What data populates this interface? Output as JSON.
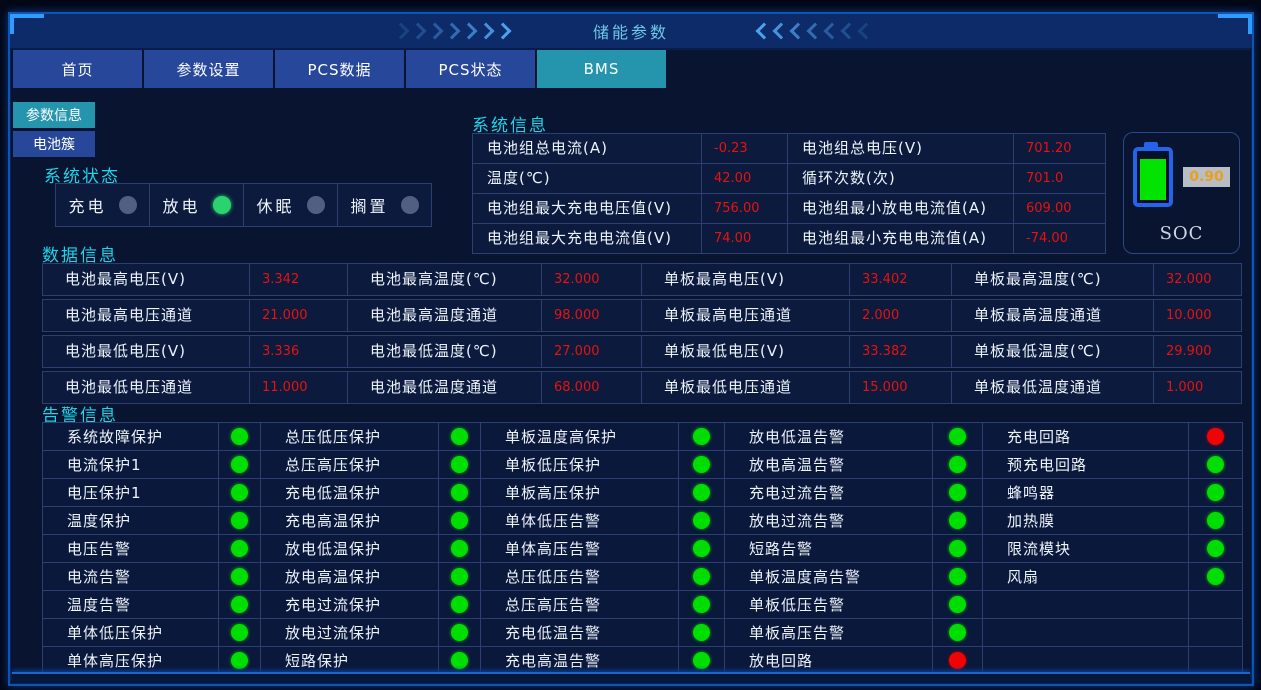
{
  "header": {
    "title": "储能参数"
  },
  "tabs": [
    {
      "name": "home",
      "label": "首页",
      "active": false
    },
    {
      "name": "param-settings",
      "label": "参数设置",
      "active": false
    },
    {
      "name": "pcs-data",
      "label": "PCS数据",
      "active": false
    },
    {
      "name": "pcs-status",
      "label": "PCS状态",
      "active": false
    },
    {
      "name": "bms",
      "label": "BMS",
      "active": true
    }
  ],
  "side_buttons": [
    {
      "name": "param-info",
      "label": "参数信息",
      "active": true
    },
    {
      "name": "battery-cluster",
      "label": "电池簇",
      "active": false
    }
  ],
  "system_status": {
    "title": "系统状态",
    "items": [
      {
        "name": "charge",
        "label": "充电",
        "state": "off"
      },
      {
        "name": "discharge",
        "label": "放电",
        "state": "on"
      },
      {
        "name": "sleep",
        "label": "休眠",
        "state": "off"
      },
      {
        "name": "idle",
        "label": "搁置",
        "state": "off"
      }
    ]
  },
  "system_info": {
    "title": "系统信息",
    "rows": [
      [
        {
          "label": "电池组总电流(A)",
          "value": "-0.23"
        },
        {
          "label": "电池组总电压(V)",
          "value": "701.20"
        }
      ],
      [
        {
          "label": "温度(℃)",
          "value": "42.00"
        },
        {
          "label": "循环次数(次)",
          "value": "701.0"
        }
      ],
      [
        {
          "label": "电池组最大充电电压值(V)",
          "value": "756.00"
        },
        {
          "label": "电池组最小放电电流值(A)",
          "value": "609.00"
        }
      ],
      [
        {
          "label": "电池组最大充电电流值(V)",
          "value": "74.00"
        },
        {
          "label": "电池组最小充电电流值(A)",
          "value": "-74.00"
        }
      ]
    ]
  },
  "soc": {
    "value": "0.90",
    "label": "SOC"
  },
  "data_info": {
    "title": "数据信息",
    "rows": [
      [
        {
          "label": "电池最高电压(V)",
          "value": "3.342"
        },
        {
          "label": "电池最高温度(℃)",
          "value": "32.000"
        },
        {
          "label": "单板最高电压(V)",
          "value": "33.402"
        },
        {
          "label": "单板最高温度(℃)",
          "value": "32.000"
        }
      ],
      [
        {
          "label": "电池最高电压通道",
          "value": "21.000"
        },
        {
          "label": "电池最高温度通道",
          "value": "98.000"
        },
        {
          "label": "单板最高电压通道",
          "value": "2.000"
        },
        {
          "label": "单板最高温度通道",
          "value": "10.000"
        }
      ],
      [
        {
          "label": "电池最低电压(V)",
          "value": "3.336"
        },
        {
          "label": "电池最低温度(℃)",
          "value": "27.000"
        },
        {
          "label": "单板最低电压(V)",
          "value": "33.382"
        },
        {
          "label": "单板最低温度(℃)",
          "value": "29.900"
        }
      ],
      [
        {
          "label": "电池最低电压通道",
          "value": "11.000"
        },
        {
          "label": "电池最低温度通道",
          "value": "68.000"
        },
        {
          "label": "单板最低电压通道",
          "value": "15.000"
        },
        {
          "label": "单板最低温度通道",
          "value": "1.000"
        }
      ]
    ]
  },
  "alarm_info": {
    "title": "告警信息",
    "rows": [
      [
        {
          "label": "系统故障保护",
          "state": "green"
        },
        {
          "label": "总压低压保护",
          "state": "green"
        },
        {
          "label": "单板温度高保护",
          "state": "green"
        },
        {
          "label": "放电低温告警",
          "state": "green"
        },
        {
          "label": "充电回路",
          "state": "red"
        }
      ],
      [
        {
          "label": "电流保护1",
          "state": "green"
        },
        {
          "label": "总压高压保护",
          "state": "green"
        },
        {
          "label": "单板低压保护",
          "state": "green"
        },
        {
          "label": "放电高温告警",
          "state": "green"
        },
        {
          "label": "预充电回路",
          "state": "green"
        }
      ],
      [
        {
          "label": "电压保护1",
          "state": "green"
        },
        {
          "label": "充电低温保护",
          "state": "green"
        },
        {
          "label": "单板高压保护",
          "state": "green"
        },
        {
          "label": "充电过流告警",
          "state": "green"
        },
        {
          "label": "蜂鸣器",
          "state": "green"
        }
      ],
      [
        {
          "label": "温度保护",
          "state": "green"
        },
        {
          "label": "充电高温保护",
          "state": "green"
        },
        {
          "label": "单体低压告警",
          "state": "green"
        },
        {
          "label": "放电过流告警",
          "state": "green"
        },
        {
          "label": "加热膜",
          "state": "green"
        }
      ],
      [
        {
          "label": "电压告警",
          "state": "green"
        },
        {
          "label": "放电低温保护",
          "state": "green"
        },
        {
          "label": "单体高压告警",
          "state": "green"
        },
        {
          "label": "短路告警",
          "state": "green"
        },
        {
          "label": "限流模块",
          "state": "green"
        }
      ],
      [
        {
          "label": "电流告警",
          "state": "green"
        },
        {
          "label": "放电高温保护",
          "state": "green"
        },
        {
          "label": "总压低压告警",
          "state": "green"
        },
        {
          "label": "单板温度高告警",
          "state": "green"
        },
        {
          "label": "风扇",
          "state": "green"
        }
      ],
      [
        {
          "label": "温度告警",
          "state": "green"
        },
        {
          "label": "充电过流保护",
          "state": "green"
        },
        {
          "label": "总压高压告警",
          "state": "green"
        },
        {
          "label": "单板低压告警",
          "state": "green"
        },
        {
          "label": "",
          "state": null
        }
      ],
      [
        {
          "label": "单体低压保护",
          "state": "green"
        },
        {
          "label": "放电过流保护",
          "state": "green"
        },
        {
          "label": "充电低温告警",
          "state": "green"
        },
        {
          "label": "单板高压告警",
          "state": "green"
        },
        {
          "label": "",
          "state": null
        }
      ],
      [
        {
          "label": "单体高压保护",
          "state": "green"
        },
        {
          "label": "短路保护",
          "state": "green"
        },
        {
          "label": "充电高温告警",
          "state": "green"
        },
        {
          "label": "放电回路",
          "state": "red"
        },
        {
          "label": "",
          "state": null
        }
      ]
    ]
  },
  "colors": {
    "accent_cyan": "#1ed3ea",
    "value_red": "#e8120e",
    "dot_green": "#00dd00",
    "dot_red": "#ee0404",
    "dot_inactive": "#525f82",
    "tab_blue": "#27479b",
    "tab_active_teal": "#2495ac",
    "frame_blue": "#1254b2",
    "soc_value_orange": "#e8a020"
  }
}
